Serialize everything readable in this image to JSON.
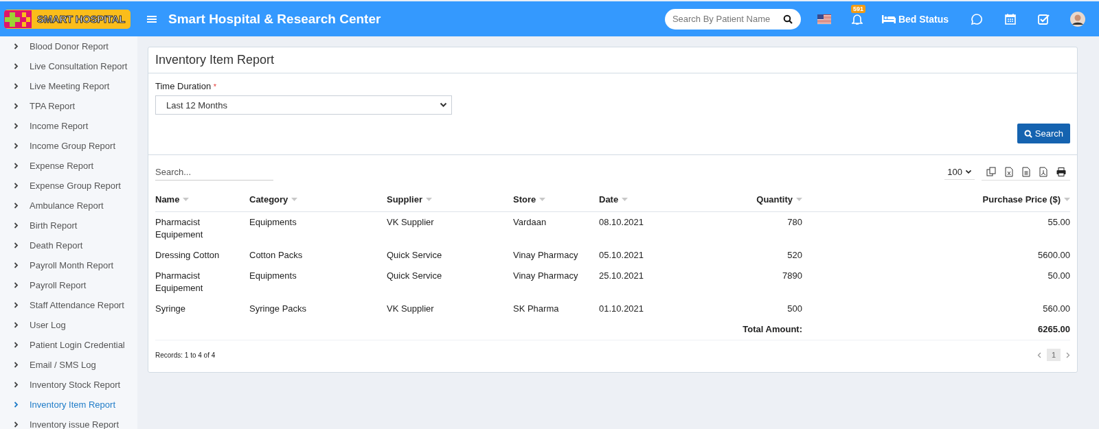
{
  "header": {
    "logo_text": "SMART HOSPITAL",
    "title": "Smart Hospital & Research Center",
    "search": {
      "placeholder": "Search By Patient Name"
    },
    "notification_count": "591",
    "bed_status": "Bed Status"
  },
  "sidebar": {
    "items": [
      {
        "label": "Blood Donor Report",
        "selected": false
      },
      {
        "label": "Live Consultation Report",
        "selected": false
      },
      {
        "label": "Live Meeting Report",
        "selected": false
      },
      {
        "label": "TPA Report",
        "selected": false
      },
      {
        "label": "Income Report",
        "selected": false
      },
      {
        "label": "Income Group Report",
        "selected": false
      },
      {
        "label": "Expense Report",
        "selected": false
      },
      {
        "label": "Expense Group Report",
        "selected": false
      },
      {
        "label": "Ambulance Report",
        "selected": false
      },
      {
        "label": "Birth Report",
        "selected": false
      },
      {
        "label": "Death Report",
        "selected": false
      },
      {
        "label": "Payroll Month Report",
        "selected": false
      },
      {
        "label": "Payroll Report",
        "selected": false
      },
      {
        "label": "Staff Attendance Report",
        "selected": false
      },
      {
        "label": "User Log",
        "selected": false
      },
      {
        "label": "Patient Login Credential",
        "selected": false
      },
      {
        "label": "Email / SMS Log",
        "selected": false
      },
      {
        "label": "Inventory Stock Report",
        "selected": false
      },
      {
        "label": "Inventory Item Report",
        "selected": true
      },
      {
        "label": "Inventory issue Report",
        "selected": false
      }
    ]
  },
  "report": {
    "title": "Inventory Item Report",
    "filter": {
      "label": "Time Duration",
      "required_mark": "*",
      "value": "Last 12 Months"
    },
    "search_button": "Search",
    "table_search": {
      "placeholder": "Search..."
    },
    "page_size": "100",
    "table": {
      "columns": [
        {
          "label": "Name",
          "kind": "text"
        },
        {
          "label": "Category",
          "kind": "text"
        },
        {
          "label": "Supplier",
          "kind": "text"
        },
        {
          "label": "Store",
          "kind": "text"
        },
        {
          "label": "Date",
          "kind": "text"
        },
        {
          "label": "Quantity",
          "kind": "number"
        },
        {
          "label": "Purchase Price ($)",
          "kind": "number"
        }
      ],
      "rows": [
        [
          "Pharmacist Equipement",
          "Equipments",
          "VK Supplier",
          "Vardaan",
          "08.10.2021",
          "780",
          "55.00"
        ],
        [
          "Dressing Cotton",
          "Cotton Packs",
          "Quick Service",
          "Vinay Pharmacy",
          "05.10.2021",
          "520",
          "5600.00"
        ],
        [
          "Pharmacist Equipement",
          "Equipments",
          "Quick Service",
          "Vinay Pharmacy",
          "25.10.2021",
          "7890",
          "50.00"
        ],
        [
          "Syringe",
          "Syringe Packs",
          "VK Supplier",
          "SK Pharma",
          "01.10.2021",
          "500",
          "560.00"
        ]
      ],
      "total_label": "Total Amount:",
      "total_value": "6265.00"
    },
    "records": "Records: 1 to 4 of 4",
    "pages": [
      {
        "label": "1",
        "selected": true
      }
    ]
  }
}
